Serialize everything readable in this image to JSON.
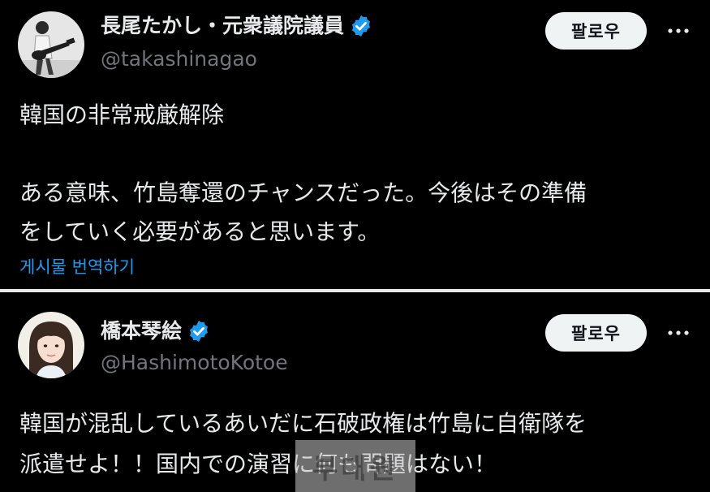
{
  "colors": {
    "background": "#000000",
    "text": "#e7e9ea",
    "secondary_text": "#71767b",
    "link": "#1d9bf0",
    "verified": "#1d9bf0",
    "follow_bg": "#eff3f4"
  },
  "tweets": [
    {
      "display_name": "長尾たかし・元衆議院議員",
      "handle": "@takashinagao",
      "verified": true,
      "avatar_icon": "guitar-player-photo",
      "follow_label": "팔로우",
      "more_icon": "more-dots-icon",
      "text_lines": [
        "韓国の非常戒厳解除",
        "ある意味、竹島奪還のチャンスだった。今後はその準備",
        "をしていく必要があると思います。"
      ],
      "translate_label": "게시물 번역하기"
    },
    {
      "display_name": "橋本琴絵",
      "handle": "@HashimotoKotoe",
      "verified": true,
      "avatar_icon": "woman-portrait-photo",
      "follow_label": "팔로우",
      "more_icon": "more-dots-icon",
      "text_lines": [
        "韓国が混乱しているあいだに石破政権は竹島に自衛隊を",
        "派遣せよ！！国内での演習に何も問題はない！"
      ]
    }
  ],
  "watermark_text": "부대원"
}
